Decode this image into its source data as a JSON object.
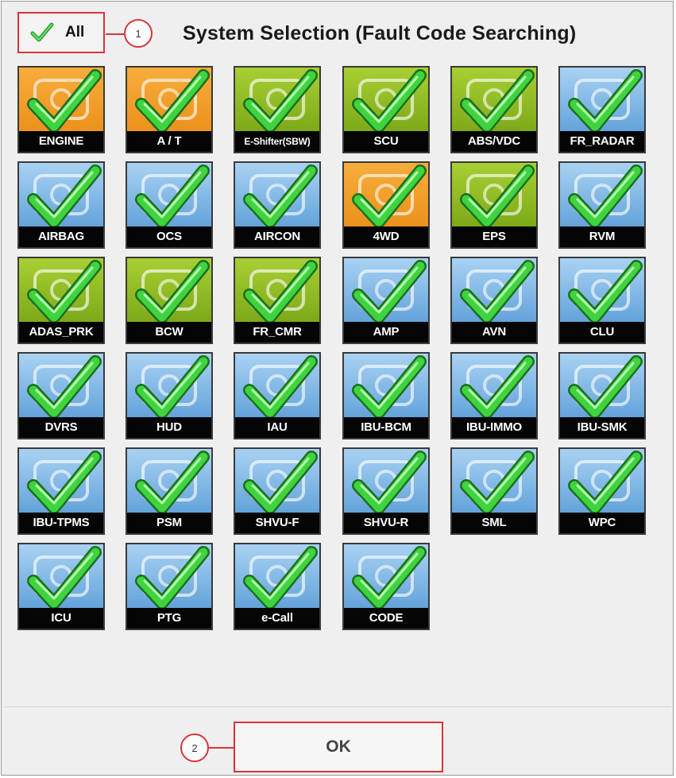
{
  "header": {
    "all_label": "All",
    "title": "System Selection (Fault Code Searching)"
  },
  "callouts": [
    "1",
    "2"
  ],
  "footer": {
    "ok_label": "OK"
  },
  "accent_colors": {
    "callout_red": "#d8343a",
    "check_green": "#3ccf3c"
  },
  "systems": [
    {
      "label": "ENGINE",
      "color": "orange",
      "icon": "engine-icon",
      "checked": true
    },
    {
      "label": "A / T",
      "color": "orange",
      "icon": "gears-icon",
      "checked": true
    },
    {
      "label": "E-Shifter(SBW)",
      "color": "green",
      "icon": "shifter-icon",
      "checked": true
    },
    {
      "label": "SCU",
      "color": "green",
      "icon": "shifter-icon",
      "checked": true
    },
    {
      "label": "ABS/VDC",
      "color": "green",
      "icon": "car-wheel-icon",
      "checked": true
    },
    {
      "label": "FR_RADAR",
      "color": "blue",
      "icon": "radar-icon",
      "checked": true
    },
    {
      "label": "AIRBAG",
      "color": "blue",
      "icon": "airbag-icon",
      "checked": true
    },
    {
      "label": "OCS",
      "color": "blue",
      "icon": "seat-icon",
      "checked": true
    },
    {
      "label": "AIRCON",
      "color": "blue",
      "icon": "aircon-icon",
      "checked": true
    },
    {
      "label": "4WD",
      "color": "orange",
      "icon": "drivetrain-icon",
      "checked": true
    },
    {
      "label": "EPS",
      "color": "green",
      "icon": "steering-wheel-icon",
      "checked": true
    },
    {
      "label": "RVM",
      "color": "blue",
      "icon": "rear-view-icon",
      "checked": true
    },
    {
      "label": "ADAS_PRK",
      "color": "green",
      "icon": "parking-icon",
      "checked": true
    },
    {
      "label": "BCW",
      "color": "green",
      "icon": "blind-spot-icon",
      "checked": true
    },
    {
      "label": "FR_CMR",
      "color": "green",
      "icon": "camera-icon",
      "checked": true
    },
    {
      "label": "AMP",
      "color": "blue",
      "icon": "speaker-icon",
      "checked": true
    },
    {
      "label": "AVN",
      "color": "blue",
      "icon": "dashboard-icon",
      "checked": true
    },
    {
      "label": "CLU",
      "color": "blue",
      "icon": "cluster-icon",
      "checked": true
    },
    {
      "label": "DVRS",
      "color": "blue",
      "icon": "camera-recorder-icon",
      "checked": true
    },
    {
      "label": "HUD",
      "color": "blue",
      "icon": "head-up-display-icon",
      "checked": true
    },
    {
      "label": "IAU",
      "color": "blue",
      "icon": "phone-key-icon",
      "checked": true
    },
    {
      "label": "IBU-BCM",
      "color": "blue",
      "icon": "ibu-icon",
      "checked": true
    },
    {
      "label": "IBU-IMMO",
      "color": "blue",
      "icon": "ibu-icon",
      "checked": true
    },
    {
      "label": "IBU-SMK",
      "color": "blue",
      "icon": "ibu-icon",
      "checked": true
    },
    {
      "label": "IBU-TPMS",
      "color": "blue",
      "icon": "ibu-icon",
      "checked": true
    },
    {
      "label": "PSM",
      "color": "blue",
      "icon": "seat-memory-icon",
      "checked": true
    },
    {
      "label": "SHVU-F",
      "color": "blue",
      "icon": "seat-heat-icon",
      "checked": true
    },
    {
      "label": "SHVU-R",
      "color": "blue",
      "icon": "seat-heat-icon",
      "checked": true
    },
    {
      "label": "SML",
      "color": "blue",
      "icon": "car-body-icon",
      "checked": true
    },
    {
      "label": "WPC",
      "color": "blue",
      "icon": "wireless-charger-icon",
      "checked": true
    },
    {
      "label": "ICU",
      "color": "blue",
      "icon": "fuse-box-icon",
      "checked": true
    },
    {
      "label": "PTG",
      "color": "blue",
      "icon": "tailgate-icon",
      "checked": true
    },
    {
      "label": "e-Call",
      "color": "blue",
      "icon": "sos-icon",
      "checked": true
    },
    {
      "label": "CODE",
      "color": "blue",
      "icon": "key-icon",
      "checked": true
    }
  ]
}
